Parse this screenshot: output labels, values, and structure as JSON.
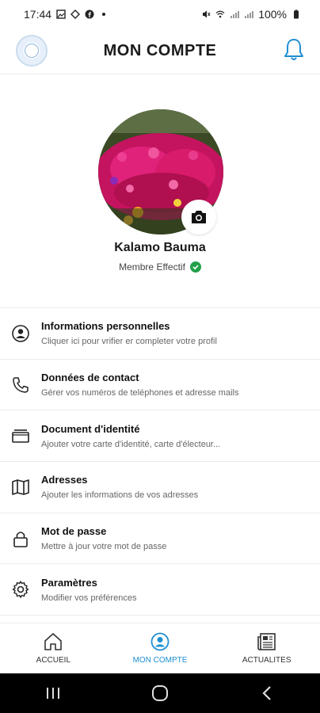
{
  "status_bar": {
    "time": "17:44",
    "battery": "100%",
    "icons_left": [
      "gallery-icon",
      "cast-icon",
      "facebook-icon",
      "dot-icon"
    ],
    "icons_right": [
      "mute-icon",
      "wifi-icon",
      "signal-icon",
      "signal-icon",
      "battery-icon"
    ]
  },
  "header": {
    "title": "MON COMPTE",
    "logo": "organization-logo",
    "bell_icon": "bell-icon"
  },
  "profile": {
    "name": "Kalamo Bauma",
    "status": "Membre Effectif",
    "verified_icon": "check-circle-icon",
    "camera_icon": "camera-icon"
  },
  "menu": {
    "items": [
      {
        "icon": "user-circle-icon",
        "title": "Informations personnelles",
        "subtitle": "Cliquer ici pour vrifier er completer votre profil"
      },
      {
        "icon": "phone-icon",
        "title": "Données de contact",
        "subtitle": "Gérer vos numéros de teléphones et adresse mails"
      },
      {
        "icon": "id-card-icon",
        "title": "Document d'identité",
        "subtitle": "Ajouter votre carte d'identité, carte d'électeur..."
      },
      {
        "icon": "map-icon",
        "title": "Adresses",
        "subtitle": "Ajouter les informations de vos adresses"
      },
      {
        "icon": "lock-icon",
        "title": "Mot de passe",
        "subtitle": "Mettre à jour votre mot de passe"
      },
      {
        "icon": "gear-icon",
        "title": "Paramètres",
        "subtitle": "Modifier vos préférences"
      }
    ]
  },
  "bottom_nav": {
    "items": [
      {
        "icon": "home-icon",
        "label": "ACCUEIL",
        "active": false
      },
      {
        "icon": "account-icon",
        "label": "MON COMPTE",
        "active": true
      },
      {
        "icon": "newspaper-icon",
        "label": "ACTUALITES",
        "active": false
      }
    ]
  },
  "colors": {
    "accent": "#1f8fd3",
    "verified": "#22a04b",
    "divider": "#ececec"
  }
}
